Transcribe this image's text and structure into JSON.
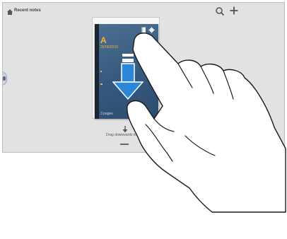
{
  "header": {
    "title": "Recent notes",
    "icons": [
      "home-icon",
      "search-icon",
      "plus-icon"
    ]
  },
  "note": {
    "title": "A",
    "date": "26/06/2016",
    "pages": "3 pages"
  },
  "hint": {
    "text": "Drag downwards to preview"
  },
  "colors": {
    "screen_bg": "#e2e2e2",
    "cover": "#3b5f84",
    "accent": "#f4b43c",
    "arrow": "#2b88d8"
  }
}
